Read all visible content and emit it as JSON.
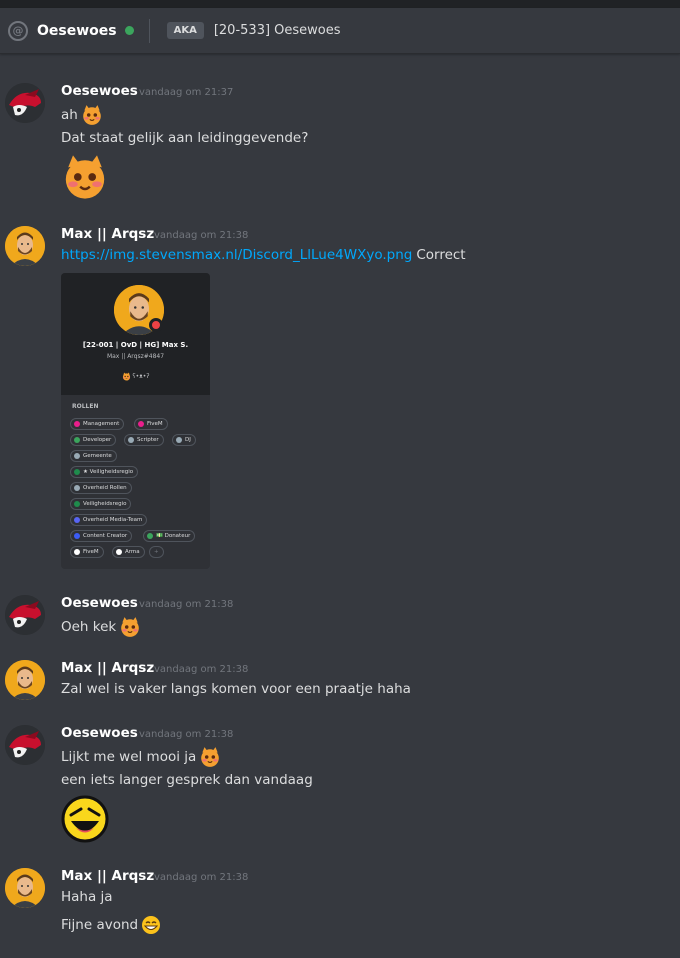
{
  "header": {
    "display_name": "Oesewoes",
    "aka_label": "AKA",
    "nickname": "[20-533] Oesewoes"
  },
  "messages": [
    {
      "author": "Oesewoes",
      "timestamp": "vandaag om 21:37",
      "lines": [
        "ah",
        "Dat staat gelijk aan leidinggevende?"
      ]
    },
    {
      "author": "Max || Arqsz",
      "timestamp": "vandaag om 21:38",
      "link": "https://img.stevensmax.nl/Discord_LlLue4WXyo.png",
      "link_suffix": "Correct"
    },
    {
      "author": "Oesewoes",
      "timestamp": "vandaag om 21:38",
      "lines": [
        "Oeh kek"
      ]
    },
    {
      "author": "Max || Arqsz",
      "timestamp": "vandaag om 21:38",
      "lines": [
        "Zal wel is vaker langs komen voor een praatje haha"
      ]
    },
    {
      "author": "Oesewoes",
      "timestamp": "vandaag om 21:38",
      "lines": [
        "Lijkt me wel mooi ja",
        "een iets langer gesprek dan vandaag"
      ]
    },
    {
      "author": "Max || Arqsz",
      "timestamp": "vandaag om 21:38",
      "lines": [
        "Haha ja",
        "Fijne avond"
      ]
    }
  ],
  "embed": {
    "profile_name": "[22-001 | OvD | HG] Max S.",
    "profile_tag": "Max || Arqsz#4847",
    "status_text": "ʕ•ᴥ•ʔ",
    "roles_title": "ROLLEN",
    "roles": [
      {
        "label": "Management",
        "color": "#e91e8c"
      },
      {
        "label": "FiveM",
        "color": "#e91e8c"
      },
      {
        "label": "Developer",
        "color": "#3ba55d"
      },
      {
        "label": "Scripter",
        "color": "#99aab5"
      },
      {
        "label": "DJ",
        "color": "#99aab5"
      },
      {
        "label": "Gemeente",
        "color": "#99aab5"
      },
      {
        "label": "★ Veiligheidsregio",
        "color": "#1f8b4c"
      },
      {
        "label": "Overheid Rollen",
        "color": "#99aab5"
      },
      {
        "label": "Veiligheidsregio",
        "color": "#1f8b4c"
      },
      {
        "label": "Overheid Media-Team",
        "color": "#5865f2"
      },
      {
        "label": "Content Creator",
        "color": "#3b5cf5"
      },
      {
        "label": "💵 Donateur",
        "color": "#3ba55d"
      },
      {
        "label": "FiveM",
        "color": "#ffffff"
      },
      {
        "label": "Arma",
        "color": "#ffffff"
      },
      {
        "label": "+",
        "color": ""
      }
    ]
  },
  "colors": {
    "link": "#00a8fc",
    "online": "#3ba55d",
    "dnd": "#ed4245"
  }
}
